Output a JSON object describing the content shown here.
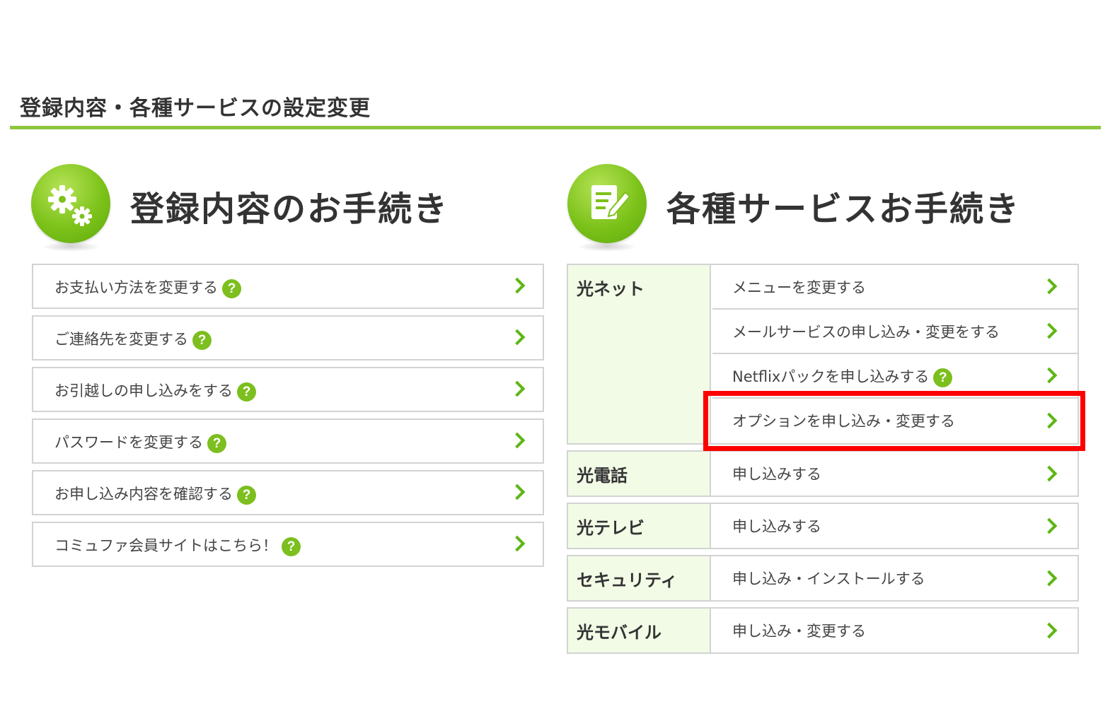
{
  "page_title": "登録内容・各種サービスの設定変更",
  "colors": {
    "accent": "#8cc63f",
    "chevron": "#5eb614",
    "highlight": "#ff0000",
    "category_bg": "#f2fbe6"
  },
  "left_section": {
    "title": "登録内容のお手続き",
    "icon": "gears-icon",
    "items": [
      {
        "label": "お支払い方法を変更する",
        "help": "?"
      },
      {
        "label": "ご連絡先を変更する",
        "help": "?"
      },
      {
        "label": "お引越しの申し込みをする",
        "help": "?"
      },
      {
        "label": "パスワードを変更する",
        "help": "?"
      },
      {
        "label": "お申し込み内容を確認する",
        "help": "?"
      },
      {
        "label": "コミュファ会員サイトはこちら！",
        "help": "?"
      }
    ]
  },
  "right_section": {
    "title": "各種サービスお手続き",
    "icon": "edit-document-icon",
    "groups": [
      {
        "category": "光ネット",
        "rows": [
          {
            "label": "メニューを変更する"
          },
          {
            "label": "メールサービスの申し込み・変更をする"
          },
          {
            "label": "Netflixパックを申し込みする",
            "help": "?"
          },
          {
            "label": "オプションを申し込み・変更する"
          }
        ]
      },
      {
        "category": "光電話",
        "rows": [
          {
            "label": "申し込みする"
          }
        ]
      },
      {
        "category": "光テレビ",
        "rows": [
          {
            "label": "申し込みする"
          }
        ]
      },
      {
        "category": "セキュリティ",
        "rows": [
          {
            "label": "申し込み・インストールする"
          }
        ]
      },
      {
        "category": "光モバイル",
        "rows": [
          {
            "label": "申し込み・変更する"
          }
        ]
      }
    ]
  }
}
